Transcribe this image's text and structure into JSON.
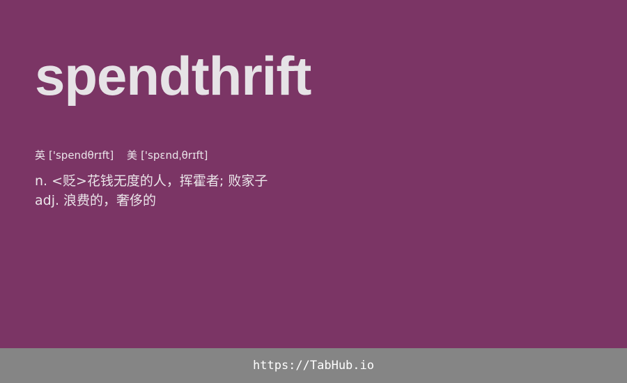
{
  "entry": {
    "word": "spendthrift",
    "phonetics": [
      {
        "region": "英",
        "ipa": "['spendθrɪft]"
      },
      {
        "region": "美",
        "ipa": "['spɛndˌθrɪft]"
      }
    ],
    "definitions": [
      {
        "pos": "n.",
        "meaning": "<贬>花钱无度的人，挥霍者; 败家子"
      },
      {
        "pos": "adj.",
        "meaning": "浪费的，奢侈的"
      }
    ]
  },
  "footer": {
    "link_text": "https://TabHub.io"
  },
  "colors": {
    "background": "#7b3565",
    "word": "#e6e3e6",
    "text": "#ebe6ea",
    "footer_bg": "#858585",
    "footer_text": "#ffffff"
  }
}
